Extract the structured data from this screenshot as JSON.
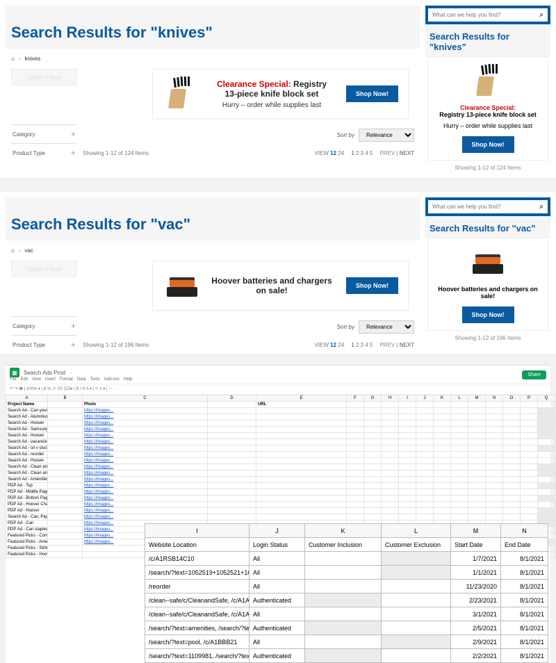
{
  "search_placeholder": "What can we help you find?",
  "panels": [
    {
      "title": "Search Results for \"knives\"",
      "mobile_title": "Search Results for \"knives\"",
      "breadcrumb_term": "knives",
      "promo_red": "Clearance Special:",
      "promo_black": " Registry 13-piece knife block set",
      "promo_sub": "Hurry – order while supplies last",
      "shop_label": "Shop Now!",
      "update_label": "Update Filters",
      "filter_category": "Category",
      "filter_type": "Product Type",
      "sort_label": "Sort by",
      "sort_value": "Relevance",
      "count_text": "Showing 1-12 of 124 Items",
      "view_label": "VIEW",
      "view_12": "12",
      "view_24": "24",
      "pages": "1  2  3  4  5",
      "prev": "PREV",
      "next": "NEXT",
      "mobile_headline": "Registry 13-piece knife block set"
    },
    {
      "title": "Search Results for \"vac\"",
      "mobile_title": "Search Results for \"vac\"",
      "breadcrumb_term": "vac",
      "promo_red": "",
      "promo_black": "Hoover batteries and chargers on sale!",
      "promo_sub": "",
      "shop_label": "Shop Now!",
      "update_label": "Update Filters",
      "filter_category": "Category",
      "filter_type": "Product Type",
      "sort_label": "Sort by",
      "sort_value": "Relevance",
      "count_text": "Showing 1-12 of 196 Items",
      "view_label": "VIEW",
      "view_12": "12",
      "view_24": "24",
      "pages": "1  2  3  4  5",
      "prev": "PREV",
      "next": "NEXT",
      "mobile_headline": "Hoover batteries and chargers on sale!"
    }
  ],
  "sheet": {
    "title": "Search Ads Prod",
    "menu": [
      "File",
      "Edit",
      "View",
      "Insert",
      "Format",
      "Data",
      "Tools",
      "Add-ons",
      "Help"
    ],
    "share": "Share",
    "col_headers": [
      "Project Name",
      "",
      "Photo",
      "",
      "URL"
    ],
    "col_i": "Website Location",
    "col_j": "Login Status",
    "col_k": "Customer Inclusion",
    "col_l": "Customer Exclusion",
    "col_m": "Start Date",
    "col_n": "End Date",
    "mini_rows": [
      {
        "a": "Search Ad - Can your Knife",
        "c": "https://images...",
        "e": ""
      },
      {
        "a": "Search Ad - Aluminium",
        "c": "https://images...",
        "e": ""
      },
      {
        "a": "Search Ad - Hoover",
        "c": "https://images...",
        "e": ""
      },
      {
        "a": "Search Ad - Samsung Shop Local",
        "c": "https://images...",
        "e": ""
      },
      {
        "a": "Search Ad - Hoover",
        "c": "https://images...",
        "e": ""
      },
      {
        "a": "Search Ad - vacancies",
        "c": "https://images...",
        "e": ""
      },
      {
        "a": "Search Ad - oil v stock",
        "c": "https://images...",
        "e": ""
      },
      {
        "a": "Search Ad - reorder",
        "c": "https://images...",
        "e": ""
      },
      {
        "a": "Search Ad - Hoover",
        "c": "https://images...",
        "e": ""
      },
      {
        "a": "Search Ad - Clean and Safe Page",
        "c": "https://images...",
        "e": ""
      },
      {
        "a": "Search Ad - Clean and Safe Page",
        "c": "https://images...",
        "e": ""
      },
      {
        "a": "Search Ad - Amenities",
        "c": "https://images...",
        "e": ""
      },
      {
        "a": "PDP Ad - Top",
        "c": "https://images...",
        "e": ""
      },
      {
        "a": "PDP Ad - Middle Page",
        "c": "https://images...",
        "e": ""
      },
      {
        "a": "PDP Ad - Bottom Page",
        "c": "https://images...",
        "e": ""
      },
      {
        "a": "PDP Ad - Hoover Chargers",
        "c": "https://images...",
        "e": ""
      },
      {
        "a": "PDP Ad - Hoover",
        "c": "https://images...",
        "e": ""
      },
      {
        "a": "Search Ad - Can, Paper, Plastic bags",
        "c": "https://images...",
        "e": ""
      },
      {
        "a": "PDP Ad - Can",
        "c": "https://images...",
        "e": ""
      },
      {
        "a": "PDP Ad - Can staples",
        "c": "https://images...",
        "e": ""
      },
      {
        "a": "Featured Picks - ContainerBox",
        "c": "https://images...",
        "e": ""
      },
      {
        "a": "Featured Picks - Amenities",
        "c": "https://images...",
        "e": ""
      },
      {
        "a": "Featured Picks - StrikZone",
        "c": "",
        "e": ""
      },
      {
        "a": "Featured Picks - Hoover",
        "c": "",
        "e": ""
      }
    ],
    "big_rows": [
      {
        "i": "/c/A1RSB14C10",
        "j": "All",
        "k": "",
        "l": "blur",
        "m": "1/7/2021",
        "n": "8/1/2021"
      },
      {
        "i": "/search/?text=1052519+1052521+10",
        "j": "All",
        "k": "",
        "l": "blur",
        "m": "1/1/2021",
        "n": "8/1/2021"
      },
      {
        "i": "/reorder",
        "j": "All",
        "k": "",
        "l": "",
        "m": "11/23/2020",
        "n": "8/1/2021"
      },
      {
        "i": "/clean--safe/c/CleanandSafe, /c/A1A",
        "j": "Authenticated",
        "k": "blur",
        "l": "",
        "m": "2/23/2021",
        "n": "8/1/2021"
      },
      {
        "i": "/clean--safe/c/CleanandSafe, /c/A1A",
        "j": "All",
        "k": "",
        "l": "",
        "m": "3/1/2021",
        "n": "8/1/2021"
      },
      {
        "i": "/search/?text=amenities, /search/?te",
        "j": "Authenticated",
        "k": "blur",
        "l": "",
        "m": "2/5/2021",
        "n": "8/1/2021"
      },
      {
        "i": "/search/?text=pool, /c/A1BBB21",
        "j": "All",
        "k": "",
        "l": "blur",
        "m": "2/9/2021",
        "n": "8/1/2021"
      },
      {
        "i": "/search/?text=1109981, /search/?tex",
        "j": "Authenticated",
        "k": "blur",
        "l": "",
        "m": "2/2/2021",
        "n": "8/1/2021"
      }
    ]
  }
}
